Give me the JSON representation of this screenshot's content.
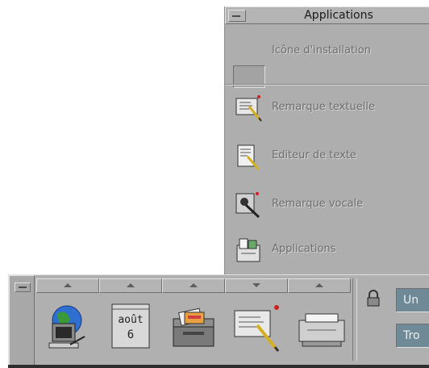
{
  "subpanel": {
    "title": "Applications",
    "items": [
      {
        "label": "Icône d'installation",
        "icon": "install-well-icon"
      },
      {
        "label": "Remarque textuelle",
        "icon": "text-note-icon"
      },
      {
        "label": "Editeur de texte",
        "icon": "text-editor-icon"
      },
      {
        "label": "Remarque vocale",
        "icon": "voice-note-icon"
      },
      {
        "label": "Applications",
        "icon": "applications-icon"
      }
    ]
  },
  "frontpanel": {
    "controls": [
      {
        "icon": "web-browser-icon",
        "arrow": "up"
      },
      {
        "icon": "calendar-icon",
        "arrow": "up",
        "month": "août",
        "day": "6"
      },
      {
        "icon": "file-manager-icon",
        "arrow": "up"
      },
      {
        "icon": "text-note-icon",
        "arrow": "down"
      },
      {
        "icon": "printer-icon",
        "arrow": "up"
      }
    ],
    "workspaces": [
      {
        "label": "Un"
      },
      {
        "label": "Tro"
      }
    ]
  }
}
